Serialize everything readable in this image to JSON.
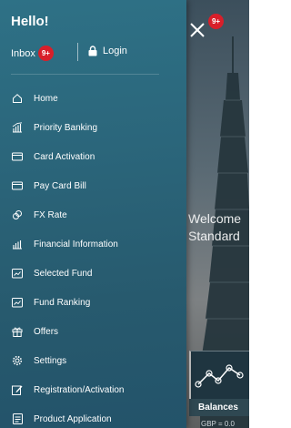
{
  "drawer": {
    "greeting": "Hello!",
    "inbox_label": "Inbox",
    "inbox_badge": "9+",
    "login_label": "Login",
    "menu": [
      {
        "label": "Home",
        "icon": "home-icon"
      },
      {
        "label": "Priority Banking",
        "icon": "priority-banking-icon"
      },
      {
        "label": "Card Activation",
        "icon": "card-icon"
      },
      {
        "label": "Pay Card Bill",
        "icon": "card-icon"
      },
      {
        "label": "FX Rate",
        "icon": "fx-rate-icon"
      },
      {
        "label": "Financial Information",
        "icon": "financial-info-icon"
      },
      {
        "label": "Selected Fund",
        "icon": "fund-icon"
      },
      {
        "label": "Fund Ranking",
        "icon": "fund-icon"
      },
      {
        "label": "Offers",
        "icon": "gift-icon"
      },
      {
        "label": "Settings",
        "icon": "gear-icon"
      },
      {
        "label": "Registration/Activation",
        "icon": "edit-icon"
      },
      {
        "label": "Product Application",
        "icon": "document-icon"
      }
    ]
  },
  "background": {
    "close_badge": "9+",
    "welcome_line1": "Welcome",
    "welcome_line2": "Standard",
    "tile_label": "Balances",
    "bottom_text": "GBP = 0.0"
  },
  "colors": {
    "drawer": "#2b667b",
    "badge": "#d81f2a",
    "green_accent": "#39b54a"
  }
}
